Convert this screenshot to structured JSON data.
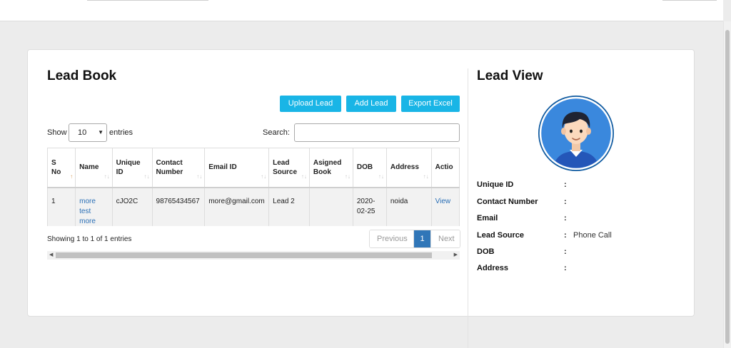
{
  "lead_book": {
    "title": "Lead Book",
    "buttons": {
      "upload": "Upload Lead",
      "add": "Add Lead",
      "export": "Export Excel"
    },
    "length": {
      "show_label": "Show",
      "value": "10",
      "entries_label": "entries"
    },
    "search_label": "Search:",
    "search_value": "",
    "columns": [
      [
        "S",
        "No"
      ],
      [
        "Name"
      ],
      [
        "Unique",
        "ID"
      ],
      [
        "Contact",
        "Number"
      ],
      [
        "Email ID"
      ],
      [
        "Lead",
        "Source"
      ],
      [
        "Asigned",
        "Book"
      ],
      [
        "DOB"
      ],
      [
        "Address"
      ],
      [
        "Actio"
      ]
    ],
    "rows": [
      {
        "sno": "1",
        "name_line1": "more test",
        "name_line2": "more test",
        "unique_id": "cJO2C",
        "contact": "98765434567",
        "email": "more@gmail.com",
        "lead_source": "Lead 2",
        "asigned_book": "",
        "dob_line1": "2020-",
        "dob_line2": "02-25",
        "address": "noida",
        "action": "View"
      }
    ],
    "info": "Showing 1 to 1 of 1 entries",
    "pager": {
      "previous": "Previous",
      "current": "1",
      "next": "Next"
    }
  },
  "lead_view": {
    "title": "Lead View",
    "fields": [
      {
        "label": "Unique ID",
        "value": ""
      },
      {
        "label": "Contact Number",
        "value": ""
      },
      {
        "label": "Email",
        "value": ""
      },
      {
        "label": "Lead Source",
        "value": "Phone Call"
      },
      {
        "label": "DOB",
        "value": ""
      },
      {
        "label": "Address",
        "value": ""
      }
    ],
    "separator": ":"
  },
  "colors": {
    "accent_button": "#19b5e6",
    "pager_active": "#3076b8",
    "link": "#2a6fb6",
    "avatar_bg": "#3a88dd"
  },
  "icons": [
    "user-avatar-icon",
    "sort-icon",
    "caret-down-icon",
    "scroll-left-icon",
    "scroll-right-icon"
  ]
}
